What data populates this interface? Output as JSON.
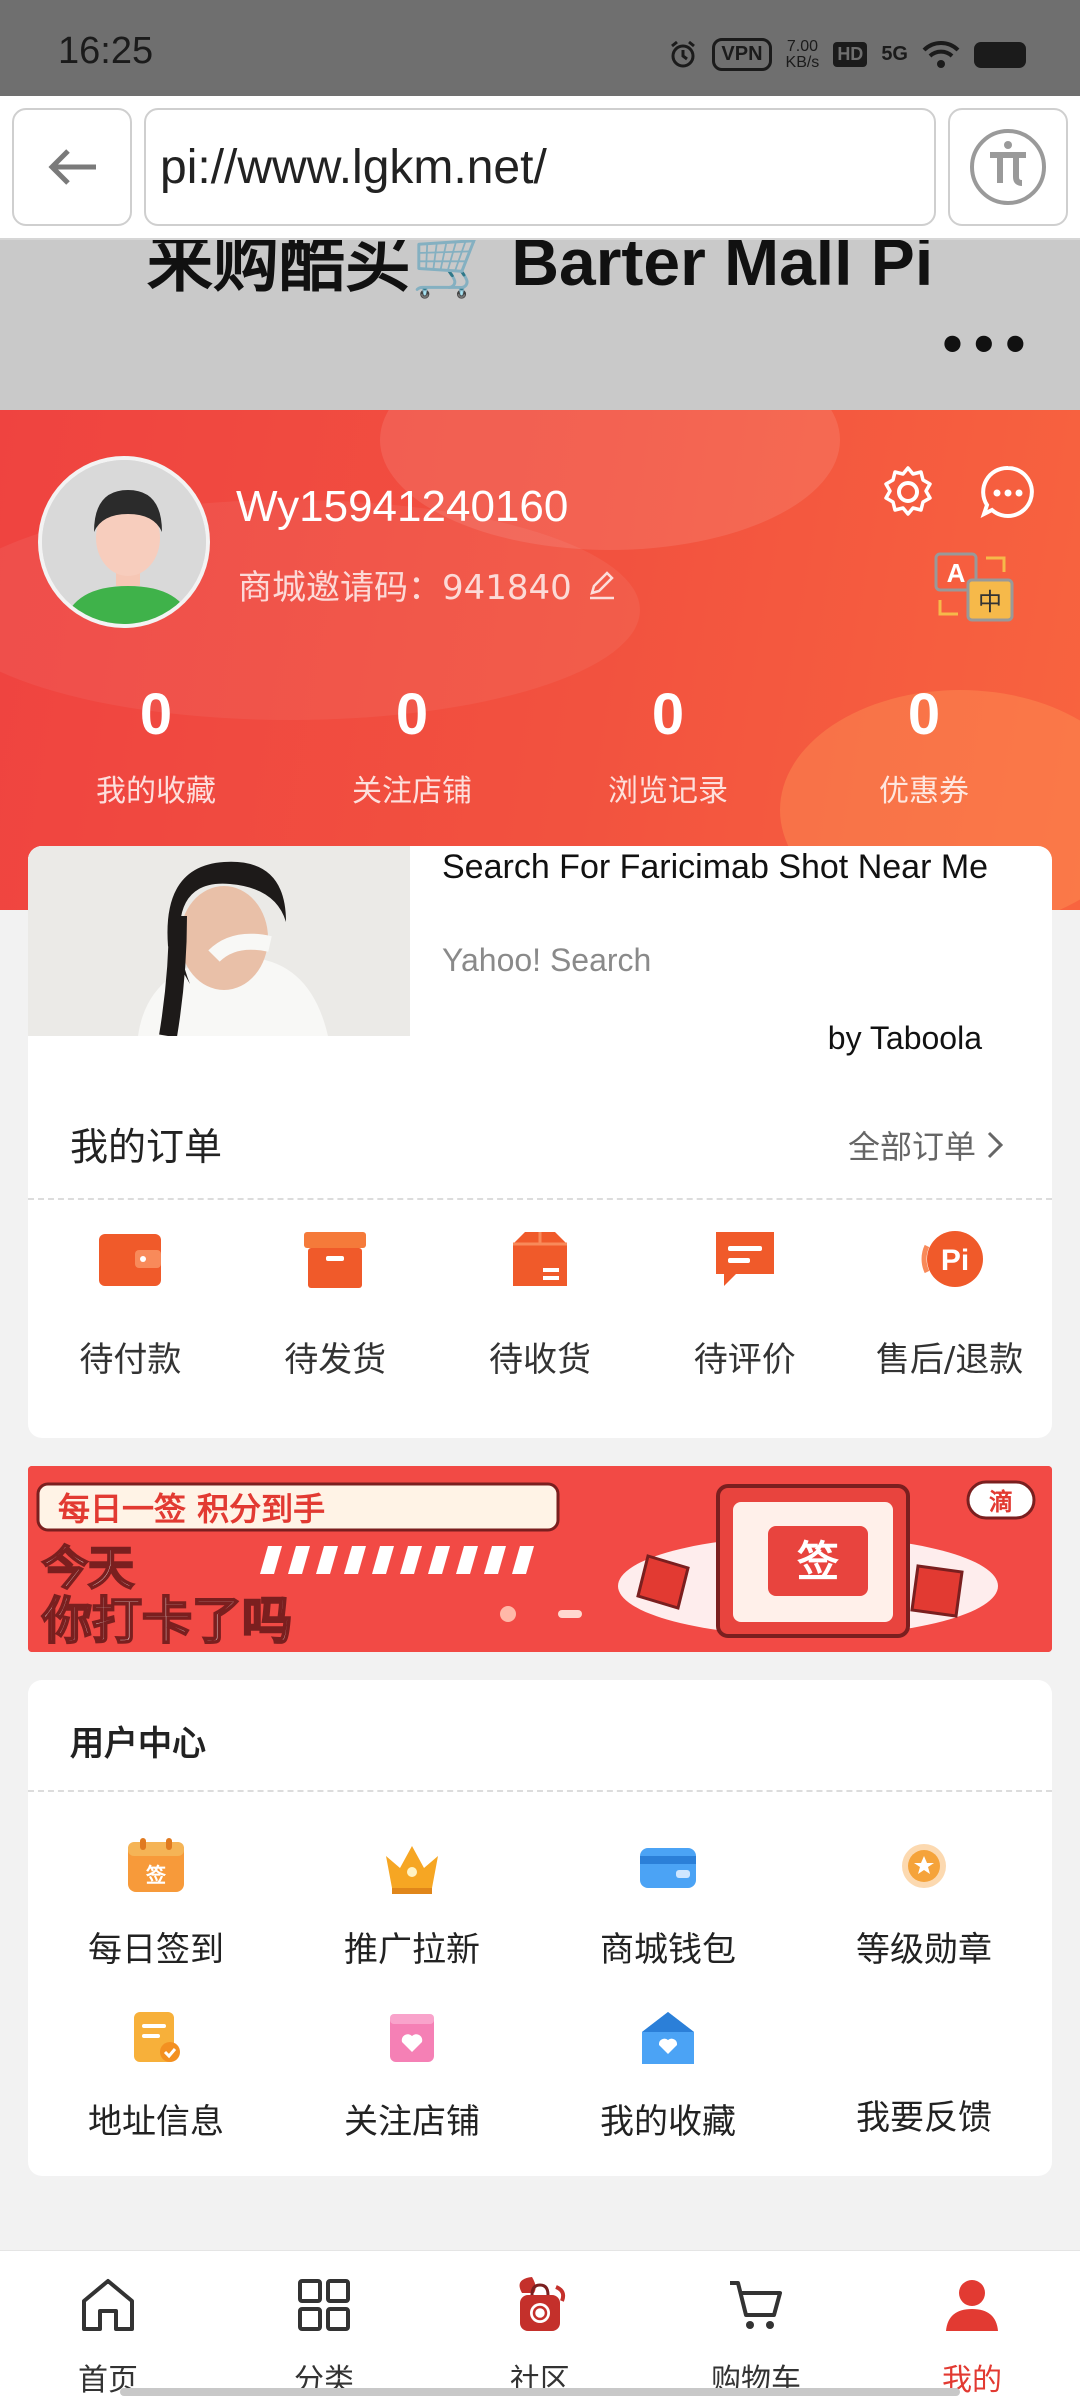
{
  "status_bar": {
    "time": "16:25",
    "vpn": "VPN",
    "net_speed": "7.00",
    "net_unit": "KB/s",
    "hd": "HD",
    "signal": "5G"
  },
  "browser": {
    "url": "pi://www.lgkm.net/"
  },
  "page": {
    "title": "来购酷买🛒 Barter Mall Pi",
    "more": "•••"
  },
  "profile": {
    "username": "Wy15941240160",
    "invite_label": "商城邀请码：",
    "invite_code": "941840",
    "stats": [
      {
        "value": "0",
        "label": "我的收藏"
      },
      {
        "value": "0",
        "label": "关注店铺"
      },
      {
        "value": "0",
        "label": "浏览记录"
      },
      {
        "value": "0",
        "label": "优惠券"
      }
    ]
  },
  "ad": {
    "title": "Search For Faricimab Shot Near Me",
    "source": "Yahoo! Search",
    "by": "by Taboola"
  },
  "orders": {
    "title": "我的订单",
    "all_label": "全部订单",
    "items": [
      {
        "label": "待付款",
        "icon": "wallet-icon"
      },
      {
        "label": "待发货",
        "icon": "box-icon"
      },
      {
        "label": "待收货",
        "icon": "package-icon"
      },
      {
        "label": "待评价",
        "icon": "comment-icon"
      },
      {
        "label": "售后/退款",
        "icon": "pi-refund-icon"
      }
    ]
  },
  "banner": {
    "line1": "每日一签 积分到手",
    "line2": "今天",
    "line3": "你打卡了吗",
    "seal": "签",
    "tag": "滴"
  },
  "user_center": {
    "title": "用户中心",
    "items": [
      {
        "label": "每日签到",
        "icon": "calendar-sign-icon"
      },
      {
        "label": "推广拉新",
        "icon": "crown-icon"
      },
      {
        "label": "商城钱包",
        "icon": "wallet-card-icon"
      },
      {
        "label": "等级勋章",
        "icon": "medal-icon"
      },
      {
        "label": "地址信息",
        "icon": "address-icon"
      },
      {
        "label": "关注店铺",
        "icon": "store-heart-icon"
      },
      {
        "label": "我的收藏",
        "icon": "house-heart-icon"
      },
      {
        "label": "我要反馈",
        "icon": "feedback-icon"
      }
    ]
  },
  "nav": {
    "items": [
      {
        "label": "首页",
        "icon": "home-icon"
      },
      {
        "label": "分类",
        "icon": "grid-icon"
      },
      {
        "label": "社区",
        "icon": "dragon-bag-icon"
      },
      {
        "label": "购物车",
        "icon": "cart-icon"
      },
      {
        "label": "我的",
        "icon": "person-icon"
      }
    ],
    "active_color": "#e23a32"
  },
  "colors": {
    "brand_red": "#ef4340",
    "orange": "#f05a2a"
  }
}
